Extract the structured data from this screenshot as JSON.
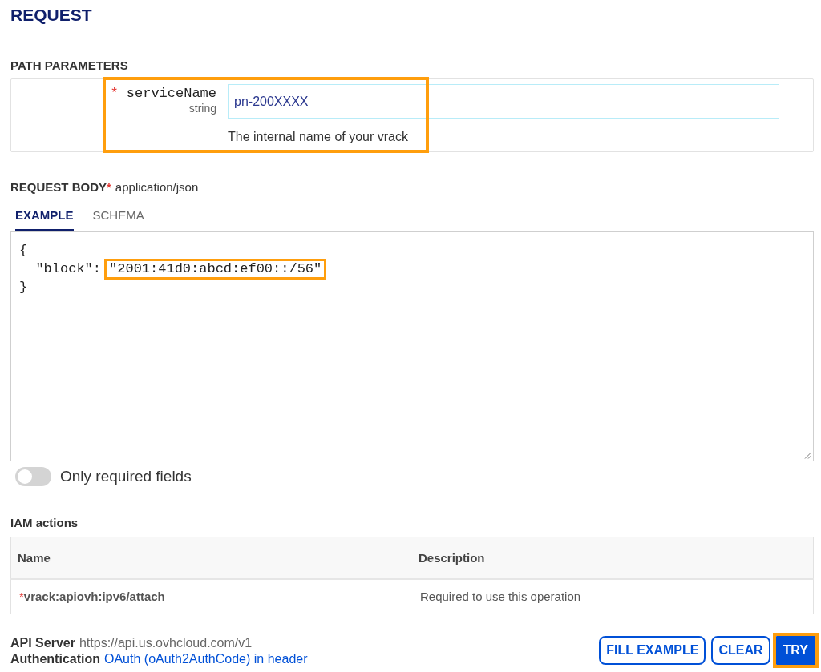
{
  "title": "REQUEST",
  "path_parameters": {
    "heading": "PATH PARAMETERS",
    "items": [
      {
        "required_mark": "*",
        "name": "serviceName",
        "type": "string",
        "value": "pn-200XXXX",
        "description": "The internal name of your vrack",
        "highlighted": true
      }
    ]
  },
  "request_body": {
    "label": "REQUEST BODY",
    "required_mark": "*",
    "content_type": "application/json",
    "tabs": [
      {
        "label": "EXAMPLE",
        "selected": true
      },
      {
        "label": "SCHEMA",
        "selected": false
      }
    ],
    "example_lines": [
      [
        {
          "text": "{",
          "highlighted": false
        }
      ],
      [
        {
          "text": "  \"block\":",
          "highlighted": false
        },
        {
          "text": "\"2001:41d0:abcd:ef00::/56\"",
          "highlighted": true
        }
      ],
      [
        {
          "text": "}",
          "highlighted": false
        }
      ]
    ]
  },
  "only_required": {
    "label": "Only required fields",
    "on": false
  },
  "iam_actions": {
    "heading": "IAM actions",
    "columns": [
      "Name",
      "Description"
    ],
    "rows": [
      {
        "required_mark": "*",
        "name": "vrack:apiovh:ipv6/attach",
        "description": "Required to use this operation"
      }
    ]
  },
  "api_server": {
    "label": "API Server",
    "value": "https://api.us.ovhcloud.com/v1"
  },
  "authentication": {
    "label": "Authentication",
    "link": "OAuth (oAuth2AuthCode) in header"
  },
  "buttons": [
    {
      "label": "FILL EXAMPLE",
      "kind": "outline",
      "highlighted": false
    },
    {
      "label": "CLEAR",
      "kind": "outline",
      "highlighted": false
    },
    {
      "label": "TRY",
      "kind": "primary",
      "highlighted": true
    }
  ]
}
